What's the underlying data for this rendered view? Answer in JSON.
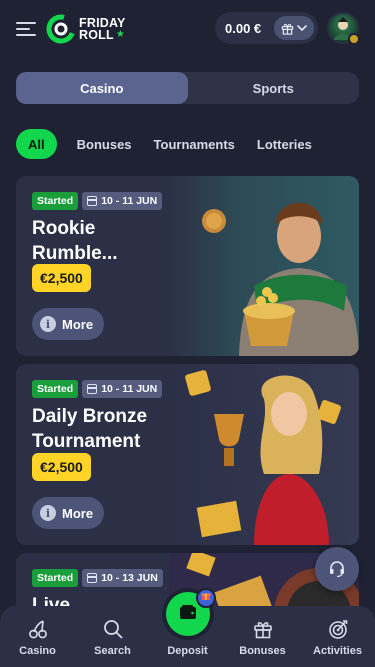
{
  "header": {
    "logo_line1": "FRIDAY",
    "logo_line2": "ROLL",
    "balance": "0.00 €"
  },
  "segment": {
    "tabs": [
      {
        "label": "Casino",
        "active": true
      },
      {
        "label": "Sports",
        "active": false
      }
    ]
  },
  "filters": [
    {
      "label": "All",
      "active": true
    },
    {
      "label": "Bonuses",
      "active": false
    },
    {
      "label": "Tournaments",
      "active": false
    },
    {
      "label": "Lotteries",
      "active": false
    }
  ],
  "cards": [
    {
      "status": "Started",
      "dates": "10 - 11 JUN",
      "title": "Rookie Rumble...",
      "prize": "€2,500",
      "more_label": "More"
    },
    {
      "status": "Started",
      "dates": "10 - 11 JUN",
      "title": "Daily Bronze Tournament",
      "prize": "€2,500",
      "more_label": "More"
    },
    {
      "status": "Started",
      "dates": "10 - 13 JUN",
      "title": "Live",
      "prize": "",
      "more_label": ""
    }
  ],
  "bottom_nav": [
    {
      "label": "Casino",
      "icon": "cherries-icon"
    },
    {
      "label": "Search",
      "icon": "search-icon"
    },
    {
      "label": "Deposit",
      "icon": "wallet-icon"
    },
    {
      "label": "Bonuses",
      "icon": "gift-icon"
    },
    {
      "label": "Activities",
      "icon": "target-icon"
    }
  ],
  "colors": {
    "background": "#1e2233",
    "card": "#2b3047",
    "accent_green": "#12d64b",
    "prize_yellow": "#ffd426",
    "started_green": "#1a9d3b"
  }
}
